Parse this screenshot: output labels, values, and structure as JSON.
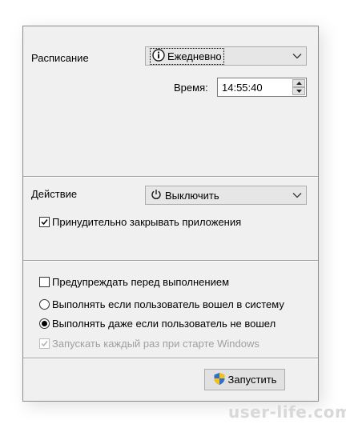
{
  "schedule": {
    "label": "Расписание",
    "selected": "Ежедневно",
    "time_label": "Время:",
    "time_value": "14:55:40"
  },
  "action": {
    "label": "Действие",
    "selected": "Выключить",
    "force_close": {
      "label": "Принудительно закрывать приложения",
      "checked": true
    }
  },
  "options": {
    "warn": {
      "label": "Предупреждать перед выполнением",
      "checked": false
    },
    "radio_logged_in": {
      "label": "Выполнять если пользователь вошел в систему",
      "selected": false
    },
    "radio_not_logged_in": {
      "label": "Выполнять даже если пользователь не вошел",
      "selected": true
    },
    "run_at_startup": {
      "label": "Запускать каждый раз при старте Windows",
      "checked": true,
      "disabled": true
    }
  },
  "footer": {
    "run_button": "Запустить"
  },
  "watermark": "user-life.com"
}
